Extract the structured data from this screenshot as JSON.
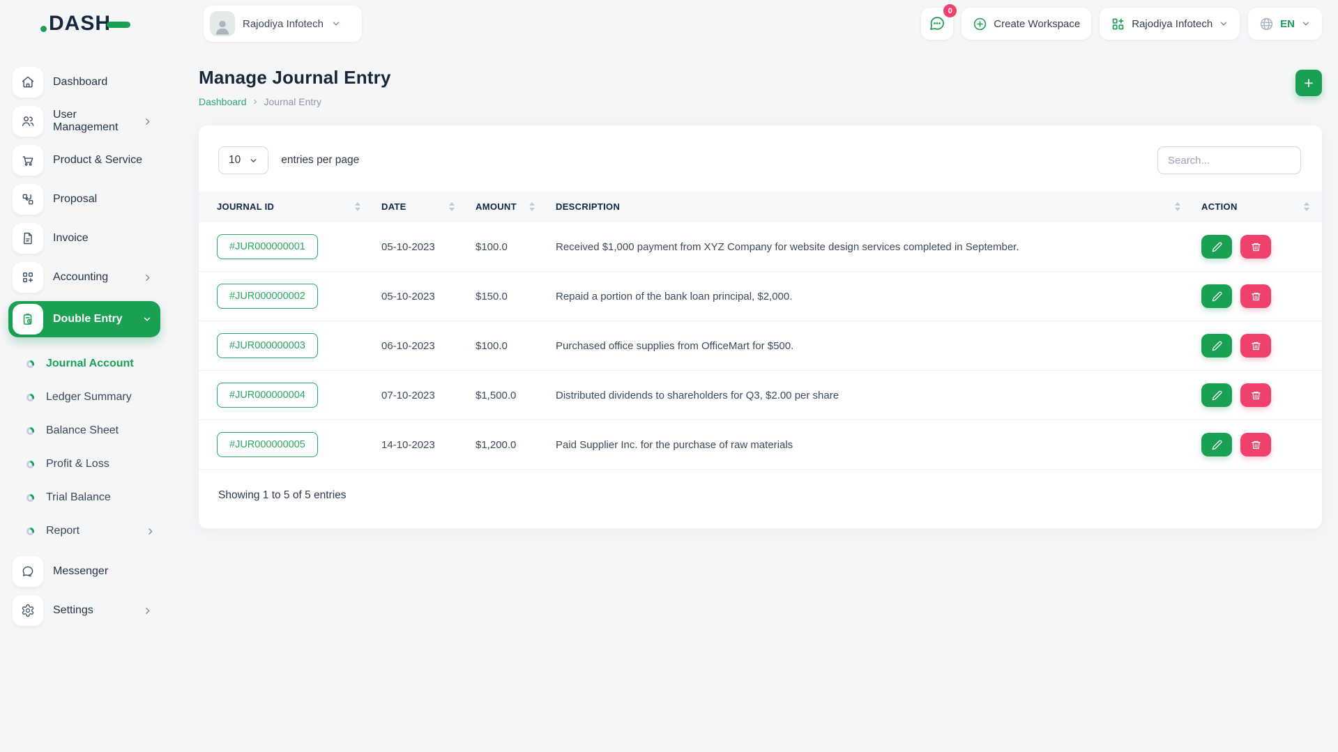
{
  "brand": {
    "name": "DASH"
  },
  "topbar": {
    "workspace_user": "Rajodiya Infotech",
    "messages_badge": "0",
    "create_workspace_label": "Create Workspace",
    "company_name": "Rajodiya Infotech",
    "language": "EN"
  },
  "sidebar": {
    "items": [
      {
        "label": "Dashboard"
      },
      {
        "label": "User Management"
      },
      {
        "label": "Product & Service"
      },
      {
        "label": "Proposal"
      },
      {
        "label": "Invoice"
      },
      {
        "label": "Accounting"
      },
      {
        "label": "Double Entry"
      },
      {
        "label": "Messenger"
      },
      {
        "label": "Settings"
      }
    ],
    "sub_items": [
      {
        "label": "Journal Account"
      },
      {
        "label": "Ledger Summary"
      },
      {
        "label": "Balance Sheet"
      },
      {
        "label": "Profit & Loss"
      },
      {
        "label": "Trial Balance"
      },
      {
        "label": "Report"
      }
    ]
  },
  "page": {
    "title": "Manage Journal Entry",
    "breadcrumb": {
      "link": "Dashboard",
      "separator": "›",
      "current": "Journal Entry"
    },
    "add_button_glyph": "+"
  },
  "table_controls": {
    "page_size": "10",
    "entries_label": "entries per page",
    "search_placeholder": "Search..."
  },
  "table": {
    "columns": [
      "JOURNAL ID",
      "DATE",
      "AMOUNT",
      "DESCRIPTION",
      "ACTION"
    ],
    "rows": [
      {
        "journal_id": "#JUR000000001",
        "date": "05-10-2023",
        "amount": "$100.0",
        "description": "Received $1,000 payment from XYZ Company for website design services completed in September."
      },
      {
        "journal_id": "#JUR000000002",
        "date": "05-10-2023",
        "amount": "$150.0",
        "description": "Repaid a portion of the bank loan principal, $2,000."
      },
      {
        "journal_id": "#JUR000000003",
        "date": "06-10-2023",
        "amount": "$100.0",
        "description": "Purchased office supplies from OfficeMart for $500."
      },
      {
        "journal_id": "#JUR000000004",
        "date": "07-10-2023",
        "amount": "$1,500.0",
        "description": "Distributed dividends to shareholders for Q3, $2.00 per share"
      },
      {
        "journal_id": "#JUR000000005",
        "date": "14-10-2023",
        "amount": "$1,200.0",
        "description": "Paid Supplier Inc. for the purchase of raw materials"
      }
    ]
  },
  "footer": {
    "showing_text": "Showing 1 to 5 of 5 entries"
  },
  "colors": {
    "primary": "#1aa053",
    "link_green": "#2da970",
    "danger": "#f0416c",
    "dark": "#12263f"
  }
}
